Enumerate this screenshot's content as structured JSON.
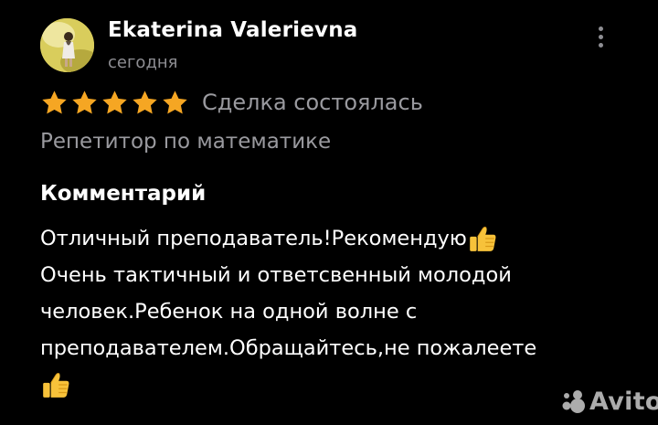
{
  "reviewer": {
    "name": "Ekaterina Valerievna",
    "date": "сегодня"
  },
  "rating": {
    "stars": 5,
    "max_stars": 5,
    "star_color": "#f5a623",
    "status": "Сделка состоялась"
  },
  "service": "Репетитор по математике",
  "comment": {
    "heading": "Комментарий",
    "lines": [
      "Отличный преподаватель!Рекомендую",
      "Очень тактичный и ответсвенный молодой",
      "человек.Ребенок на одной волне с",
      "преподавателем.Обращайтесь,не пожалеете"
    ],
    "emoji": "thumbs-up-icon"
  },
  "watermark": {
    "text": "Avito"
  },
  "colors": {
    "background": "#000000",
    "secondary_text": "#9a9a9f",
    "emoji_yellow": "#f7c23a"
  }
}
